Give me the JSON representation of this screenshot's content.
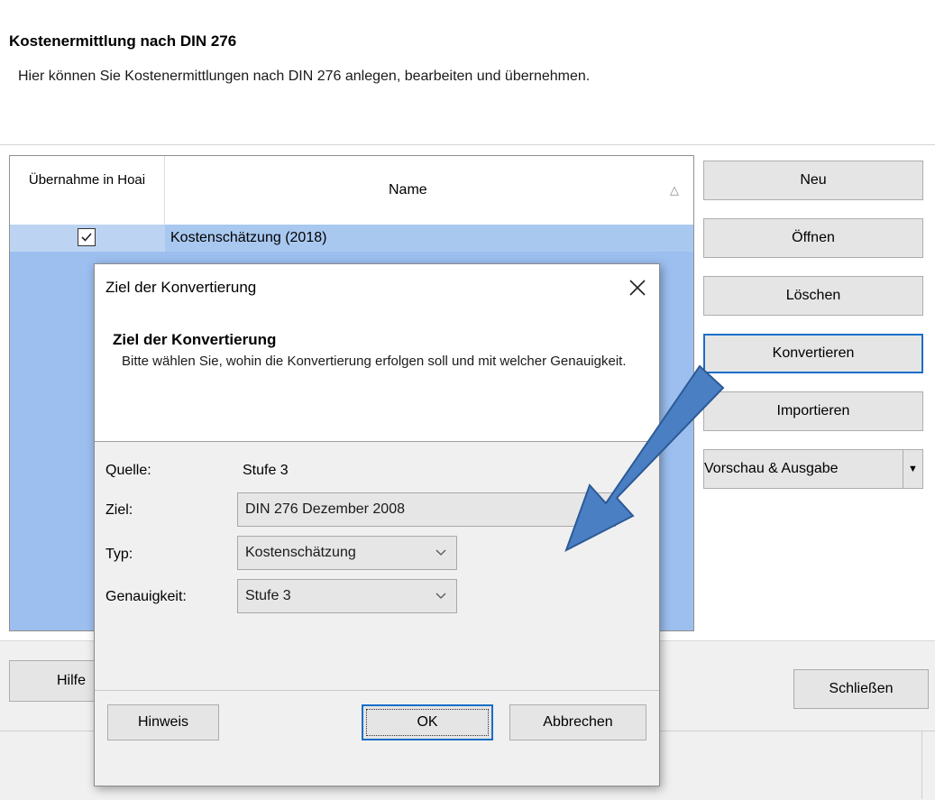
{
  "header": {
    "title": "Kostenermittlung nach DIN 276",
    "description": "Hier können Sie Kostenermittlungen nach DIN 276 anlegen, bearbeiten und übernehmen."
  },
  "list": {
    "columns": {
      "uebernahme": "Übernahme in Hoai",
      "name": "Name"
    },
    "sort_icon": "triangle-up-icon",
    "rows": [
      {
        "checked": true,
        "name": "Kostenschätzung (2018)"
      }
    ]
  },
  "side_buttons": {
    "neu": "Neu",
    "oeffnen": "Öffnen",
    "loeschen": "Löschen",
    "konvertieren": "Konvertieren",
    "importieren": "Importieren",
    "vorschau": "Vorschau & Ausgabe"
  },
  "bottom": {
    "hilfe": "Hilfe",
    "schliessen": "Schließen"
  },
  "dialog": {
    "window_title": "Ziel der Konvertierung",
    "heading": "Ziel der Konvertierung",
    "text": "Bitte wählen Sie, wohin die Konvertierung erfolgen soll und mit welcher Genauigkeit.",
    "fields": {
      "quelle_label": "Quelle:",
      "quelle_value": "Stufe 3",
      "ziel_label": "Ziel:",
      "ziel_value": "DIN 276 Dezember 2008",
      "typ_label": "Typ:",
      "typ_value": "Kostenschätzung",
      "genauigkeit_label": "Genauigkeit:",
      "genauigkeit_value": "Stufe 3"
    },
    "buttons": {
      "hinweis": "Hinweis",
      "ok": "OK",
      "abbrechen": "Abbrechen"
    }
  },
  "colors": {
    "selection": "#9cbff0",
    "focus_border": "#1a6ec7",
    "annotation_arrow": "#4a7fc4"
  }
}
